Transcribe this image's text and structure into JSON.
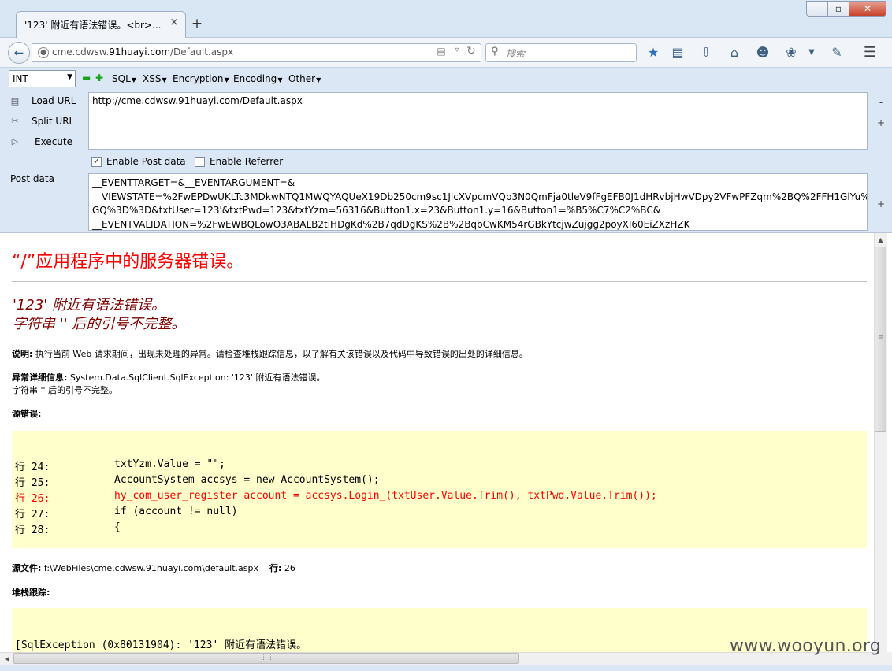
{
  "browser": {
    "tab_title": "'123' 附近有语法错误。<br>...",
    "tab_close": "×",
    "new_tab": "+",
    "window_buttons": {
      "min": "—",
      "max": "▫",
      "close": "✕"
    },
    "url_prefix": "cme.cdwsw.",
    "url_domain": "91huayi.com",
    "url_path": "/Default.aspx",
    "search_placeholder": "搜索"
  },
  "hackbar": {
    "type_select": "INT",
    "menus": [
      "SQL",
      "XSS",
      "Encryption",
      "Encoding",
      "Other"
    ],
    "load_url": "Load URL",
    "split_url": "Split URL",
    "execute": "Execute",
    "url_value": "http://cme.cdwsw.91huayi.com/Default.aspx",
    "enable_post": "Enable Post data",
    "enable_referrer": "Enable Referrer",
    "post_label": "Post data",
    "post_lines": [
      "__EVENTTARGET=&__EVENTARGUMENT=&",
      "__VIEWSTATE=%2FwEPDwUKLTc3MDkwNTQ1MWQYAQUeX19Db250cm9sc1JlcXVpcmVQb3N0QmFja0tleV9fFgEFB0J1dHRvbjHwVDpy2VFwPFZqm%2BQ%2FFH1GlYu%2B",
      "GQ%3D%3D&txtUser=123'&txtPwd=123&txtYzm=56316&Button1.x=23&Button1.y=16&Button1=%B5%C7%C2%BC&",
      "__EVENTVALIDATION=%2FwEWBQLowO3ABALB2tiHDgKd%2B7qdDgKS%2B%2BqbCwKM54rGBkYtcjwZujgg2poyXI60EiZXzHZK"
    ],
    "minus": "-",
    "plus": "+"
  },
  "page": {
    "title": "“/”应用程序中的服务器错误。",
    "error_line1": "'123' 附近有语法错误。",
    "error_line2": "字符串 '' 后的引号不完整。",
    "desc_label": "说明:",
    "desc_text": " 执行当前 Web 请求期间，出现未处理的异常。请检查堆栈跟踪信息，以了解有关该错误以及代码中导致错误的出处的详细信息。",
    "exc_label": "异常详细信息:",
    "exc_text": " System.Data.SqlClient.SqlException: '123' 附近有语法错误。",
    "exc_text2": "字符串 '' 后的引号不完整。",
    "source_error_label": "源错误:",
    "code_lines": [
      {
        "num": "行 24:",
        "code": "txtYzm.Value = \"\";"
      },
      {
        "num": "行 25:",
        "code": "AccountSystem accsys = new AccountSystem();"
      },
      {
        "num": "行 26:",
        "code": "hy_com_user_register account = accsys.Login_(txtUser.Value.Trim(), txtPwd.Value.Trim());"
      },
      {
        "num": "行 27:",
        "code": "if (account != null)"
      },
      {
        "num": "行 28:",
        "code": "{"
      }
    ],
    "source_file_label": "源文件:",
    "source_file": " f:\\WebFiles\\cme.cdwsw.91huayi.com\\default.aspx",
    "line_label": "行:",
    "line_value": " 26",
    "stack_label": "堆栈跟踪:",
    "stack_line": "[SqlException (0x80131904): '123' 附近有语法错误。"
  },
  "watermark": "www.wooyun.org"
}
